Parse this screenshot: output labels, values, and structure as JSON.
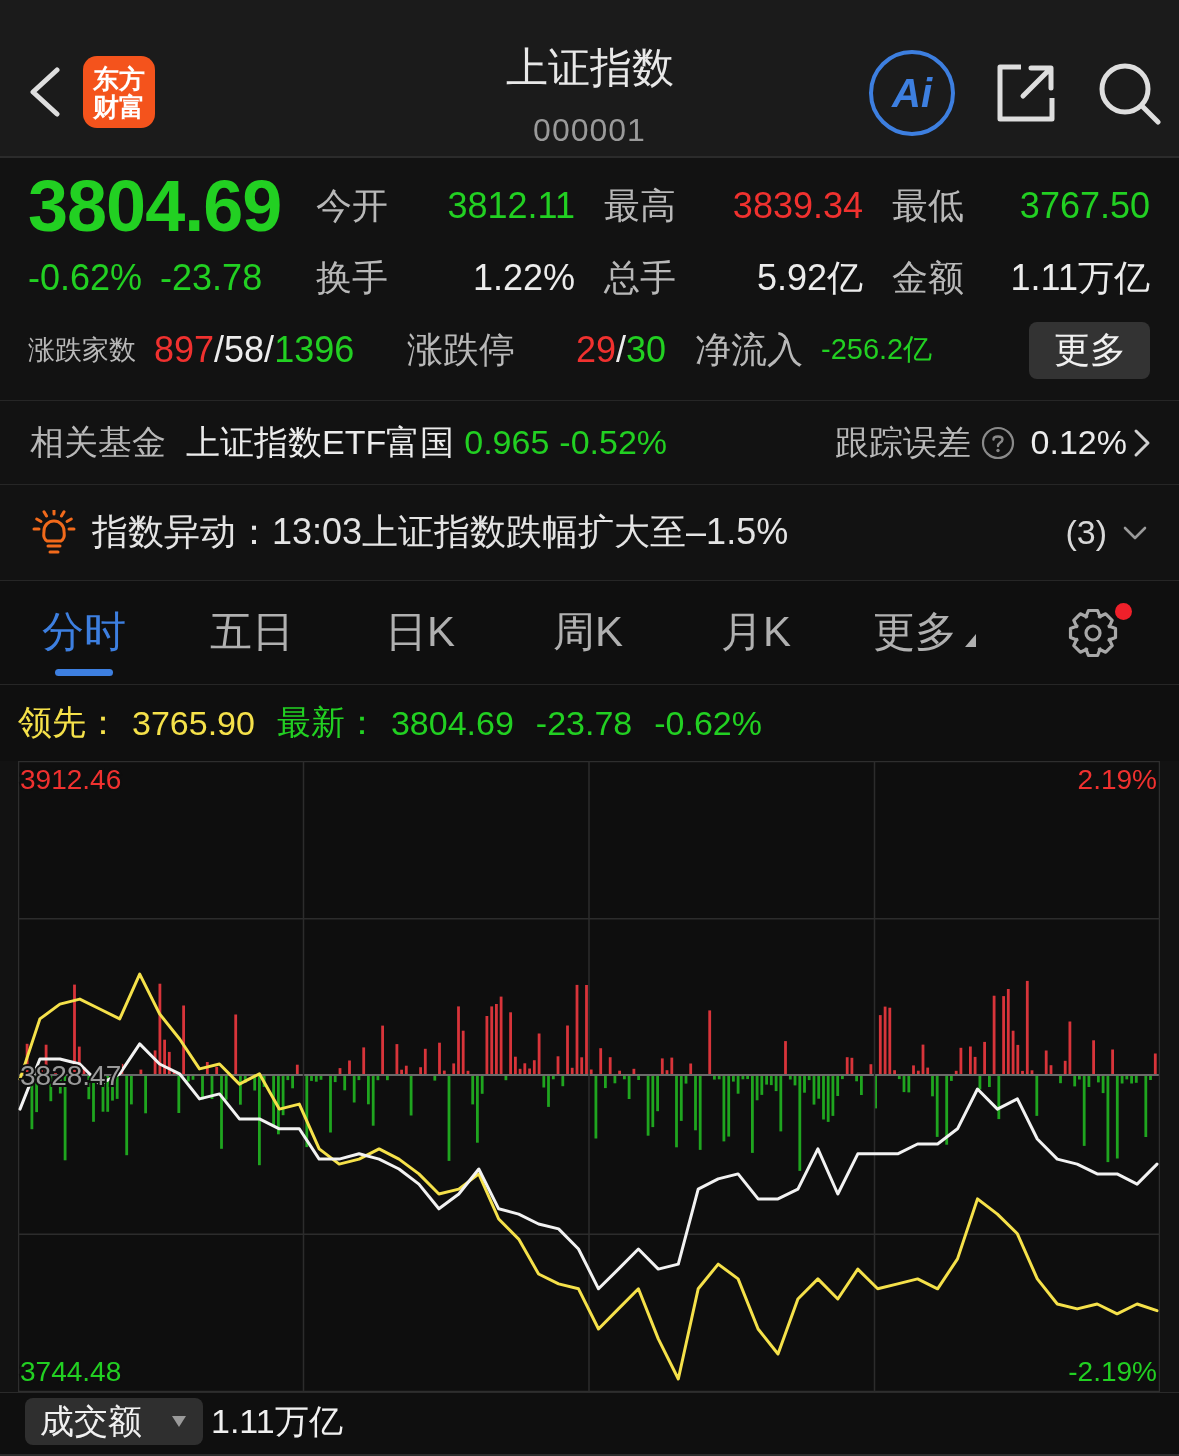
{
  "header": {
    "logo": "东方财富",
    "title": "上证指数",
    "code": "000001",
    "ai_button": "Ai"
  },
  "quote": {
    "price": "3804.69",
    "change_percent": "-0.62%",
    "change": "-23.78",
    "falling": true,
    "stats": [
      {
        "label": "今开",
        "value": "3812.11",
        "color": "#22d022"
      },
      {
        "label": "最高",
        "value": "3839.34",
        "color": "#f0312f"
      },
      {
        "label": "最低",
        "value": "3767.50",
        "color": "#22d022"
      },
      {
        "label": "换手",
        "value": "1.22%",
        "color": "#ececec"
      },
      {
        "label": "总手",
        "value": "5.92亿",
        "color": "#ececec"
      },
      {
        "label": "金额",
        "value": "1.11万亿",
        "color": "#ececec"
      }
    ],
    "breadth": {
      "label": "涨跌家数",
      "parts": [
        {
          "text": "897",
          "color": "#f0312f"
        },
        {
          "text": "/58/",
          "color": "#ececec"
        },
        {
          "text": "1396",
          "color": "#22d022"
        }
      ]
    },
    "limits": {
      "label": "涨跌停",
      "parts": [
        {
          "text": "29",
          "color": "#f0312f"
        },
        {
          "text": "/",
          "color": "#ececec"
        },
        {
          "text": "30",
          "color": "#22d022"
        }
      ]
    },
    "net_inflow": {
      "label": "净流入",
      "value": "-256.2亿",
      "falling": true
    },
    "more_button": "更多"
  },
  "fund": {
    "label": "相关基金",
    "name": "上证指数ETF富国",
    "price": "0.965",
    "change": "-0.52%",
    "falling": true,
    "tracking_label": "跟踪误差",
    "tracking_value": "0.12%"
  },
  "alert": {
    "label": "指数异动：",
    "message": "13:03上证指数跌幅扩大至–1.5%",
    "count": "(3)",
    "expanded": false
  },
  "chart_tabs": {
    "tabs": [
      {
        "label": "分时",
        "selected": true,
        "kind": "period"
      },
      {
        "label": "五日",
        "selected": false,
        "kind": "period"
      },
      {
        "label": "日K",
        "selected": false,
        "kind": "period"
      },
      {
        "label": "周K",
        "selected": false,
        "kind": "period"
      },
      {
        "label": "月K",
        "selected": false,
        "kind": "period"
      },
      {
        "label": "更多",
        "selected": false,
        "kind": "menu"
      }
    ],
    "settings_notification": true
  },
  "legend": {
    "leading_label": "领先：",
    "leading_value": "3765.90",
    "latest_label": "最新：",
    "latest_value": "3804.69",
    "change": "-23.78",
    "change_percent": "-0.62%",
    "falling": true
  },
  "chart": {
    "right_labels": [
      "2.19%",
      "-2.19%"
    ],
    "chart_data": {
      "type": "line",
      "ylim": [
        3738.52,
        3917.57
      ],
      "yticks": [
        3744.48,
        3828.47,
        3912.46
      ],
      "series": [
        {
          "color": "#f5e14a",
          "values": [
            3827.3,
            3844.4,
            3848.6,
            3850.0,
            3847.2,
            3844.4,
            3857.1,
            3845.8,
            3838.7,
            3830.2,
            3831.6,
            3825.9,
            3828.8,
            3818.8,
            3820.2,
            3807.5,
            3803.2,
            3804.6,
            3807.5,
            3804.6,
            3800.4,
            3794.7,
            3796.1,
            3800.4,
            3787.6,
            3781.9,
            3772.0,
            3769.2,
            3767.8,
            3756.4,
            3762.1,
            3767.8,
            3753.6,
            3742.2,
            3767.8,
            3774.8,
            3770.6,
            3756.4,
            3749.3,
            3764.9,
            3770.6,
            3764.9,
            3773.4,
            3767.8,
            3769.2,
            3770.6,
            3767.8,
            3776.3,
            3793.3,
            3789.0,
            3783.4,
            3770.6,
            3763.5,
            3762.1,
            3763.5,
            3760.7,
            3763.5,
            3761.6
          ]
        },
        {
          "color": "#f2f2f2",
          "values": [
            3818.8,
            3833.0,
            3833.0,
            3831.6,
            3825.9,
            3828.8,
            3837.3,
            3831.6,
            3828.8,
            3821.7,
            3823.1,
            3816.0,
            3816.0,
            3813.2,
            3813.2,
            3804.6,
            3804.6,
            3806.1,
            3804.6,
            3801.8,
            3797.5,
            3790.5,
            3794.7,
            3801.8,
            3790.5,
            3789.0,
            3786.2,
            3784.8,
            3779.1,
            3767.8,
            3773.4,
            3779.1,
            3773.4,
            3774.8,
            3796.1,
            3799.0,
            3800.4,
            3793.3,
            3793.3,
            3796.1,
            3807.5,
            3794.7,
            3806.1,
            3806.1,
            3806.1,
            3808.9,
            3808.9,
            3813.2,
            3824.5,
            3818.8,
            3821.7,
            3810.3,
            3804.6,
            3803.2,
            3800.4,
            3800.4,
            3797.5,
            3803.2
          ]
        }
      ]
    }
  },
  "footer": {
    "selector": "成交额",
    "value": "1.11万亿"
  }
}
